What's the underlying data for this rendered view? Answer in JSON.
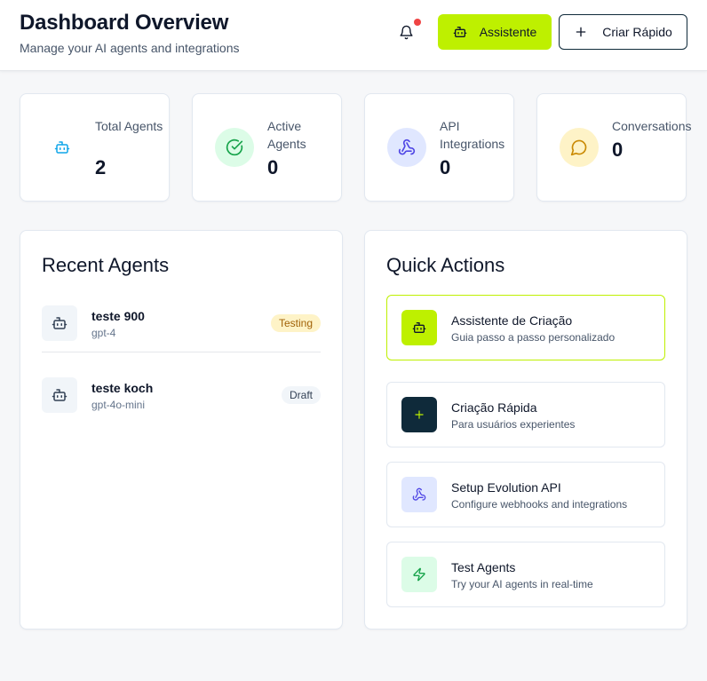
{
  "header": {
    "title": "Dashboard Overview",
    "subtitle": "Manage your AI agents and integrations",
    "assist_label": "Assistente",
    "quick_label": "Criar Rápido",
    "bell_icon": "bell-icon",
    "has_notification": true
  },
  "colors": {
    "accent": "#bef000",
    "dark": "#0f2a3a",
    "notification": "#ef4444"
  },
  "stats": [
    {
      "label": "Total Agents",
      "value": "2",
      "icon": "bot-icon"
    },
    {
      "label": "Active Agents",
      "value": "0",
      "icon": "check-circle-icon"
    },
    {
      "label": "API Integrations",
      "value": "0",
      "icon": "webhook-icon"
    },
    {
      "label": "Conversations",
      "value": "0",
      "icon": "message-circle-icon"
    }
  ],
  "recent_agents": {
    "title": "Recent Agents",
    "items": [
      {
        "name": "teste 900",
        "model": "gpt-4",
        "status": "Testing"
      },
      {
        "name": "teste koch",
        "model": "gpt-4o-mini",
        "status": "Draft"
      }
    ]
  },
  "quick_actions": {
    "title": "Quick Actions",
    "items": [
      {
        "title": "Assistente de Criação",
        "desc": "Guia passo a passo personalizado",
        "icon": "bot-icon"
      },
      {
        "title": "Criação Rápida",
        "desc": "Para usuários experientes",
        "icon": "plus-icon"
      },
      {
        "title": "Setup Evolution API",
        "desc": "Configure webhooks and integrations",
        "icon": "webhook-icon"
      },
      {
        "title": "Test Agents",
        "desc": "Try your AI agents in real-time",
        "icon": "zap-icon"
      }
    ]
  }
}
